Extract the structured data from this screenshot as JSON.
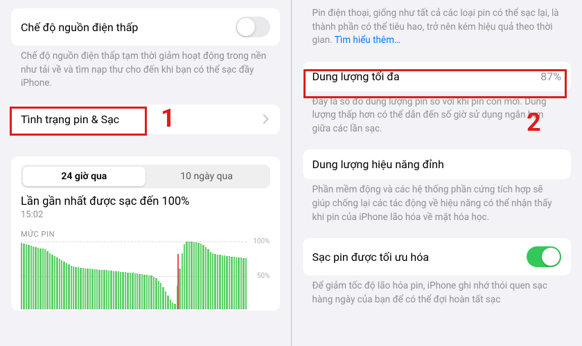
{
  "left": {
    "low_power": {
      "title": "Chế độ nguồn điện thấp",
      "on": false,
      "caption": "Chế độ nguồn điện thấp tạm thời giảm hoạt động trong nền như tải về và tìm nạp thư cho đến khi bạn có thể sạc đầy iPhone."
    },
    "battery_status": {
      "title": "Tình trạng pin & Sạc"
    },
    "seg": {
      "a": "24 giờ qua",
      "b": "10 ngày qua"
    },
    "last_charge": {
      "title": "Lần gần nhất được sạc đến 100%",
      "time": "15:02"
    },
    "level_label": "MỨC PIN"
  },
  "right": {
    "intro_caption": "Pin điện thoại, giống như tất cả các loại pin có thể sạc lại, là thành phần có thể tiêu hao, trở nên kém hiệu quả theo thời gian. ",
    "intro_link": "Tìm hiểu thêm…",
    "max_capacity": {
      "title": "Dung lượng tối đa",
      "value": "87%",
      "caption": "Đây là số đo dung lượng pin so với khi pin còn mới. Dung lượng thấp hơn có thể dẫn đến số giờ sử dụng ngắn hơn giữa các lần sạc."
    },
    "peak_perf": {
      "title": "Dung lượng hiệu năng đỉnh",
      "caption": "Phần mềm động và các hệ thống phần cứng tích hợp sẽ giúp chống lại các tác động về hiệu năng có thể nhận thấy khi pin của iPhone lão hóa về mặt hóa học."
    },
    "optimized": {
      "title": "Sạc pin được tối ưu hóa",
      "on": true,
      "caption": "Để giảm tốc độ lão hóa pin, iPhone ghi nhớ thói quen sạc hàng ngày của bạn để có thể đợi hoàn tất sạc"
    }
  },
  "markers": {
    "one": "1",
    "two": "2"
  },
  "chart_data": {
    "type": "bar",
    "title": "MỨC PIN",
    "ylabel": "%",
    "ylim": [
      0,
      100
    ],
    "yticks": [
      50,
      100
    ],
    "categories_count": 96,
    "values": [
      98,
      97,
      96,
      95,
      94,
      93,
      92,
      91,
      90,
      89,
      88,
      85,
      82,
      80,
      78,
      76,
      74,
      72,
      70,
      68,
      66,
      64,
      63,
      62,
      62,
      61,
      61,
      60,
      60,
      60,
      59,
      59,
      59,
      58,
      58,
      58,
      58,
      57,
      57,
      56,
      56,
      56,
      55,
      55,
      55,
      54,
      54,
      54,
      53,
      53,
      52,
      52,
      51,
      51,
      50,
      50,
      48,
      46,
      42,
      38,
      32,
      26,
      20,
      14,
      10,
      8,
      34,
      60,
      82,
      96,
      100,
      100,
      100,
      99,
      99,
      98,
      97,
      95,
      92,
      88,
      84,
      82,
      81,
      80,
      80,
      79,
      79,
      78,
      78,
      77,
      77,
      76,
      76,
      76,
      75,
      75
    ],
    "red_marker_index": 65
  }
}
